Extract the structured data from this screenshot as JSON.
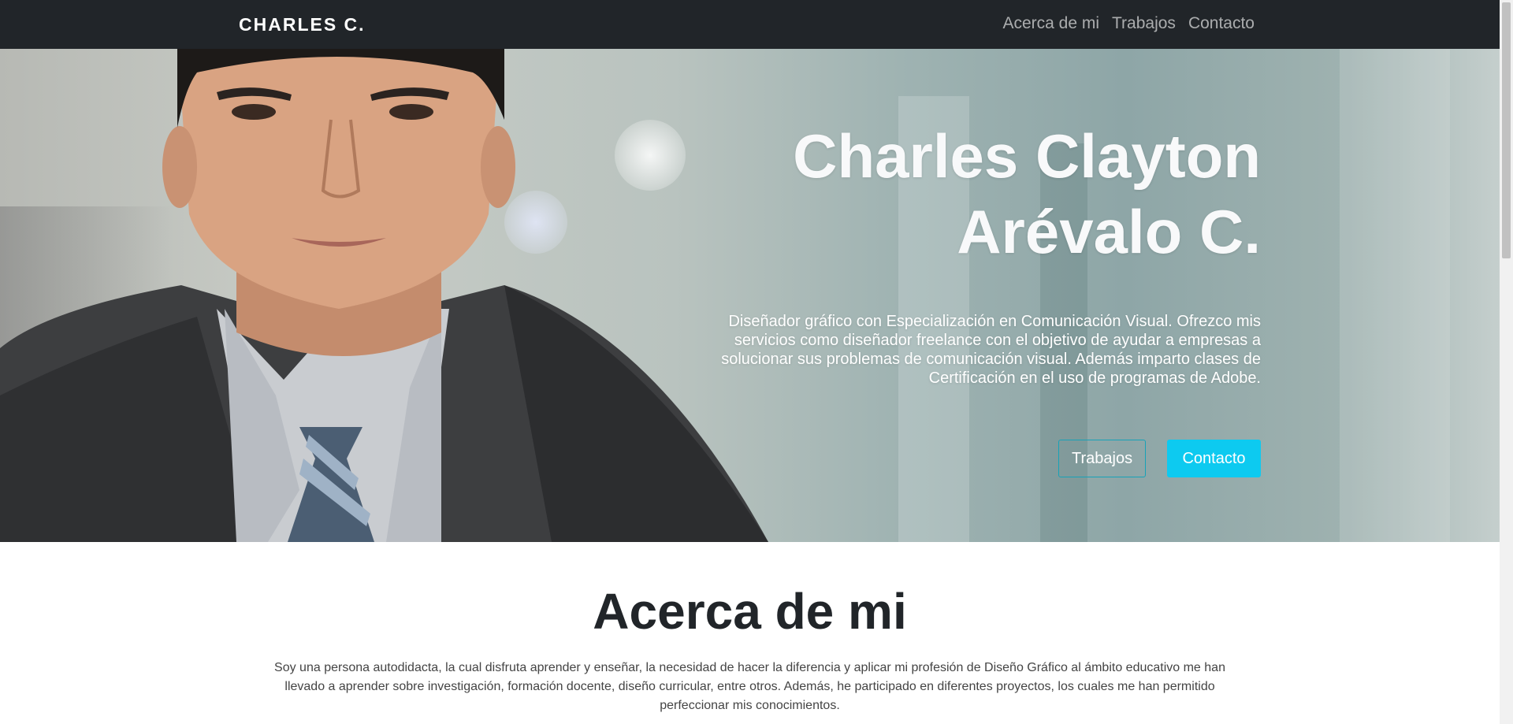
{
  "navbar": {
    "brand": "CHARLES C.",
    "links": [
      "Acerca de mi",
      "Trabajos",
      "Contacto"
    ]
  },
  "hero": {
    "title_line1": "Charles Clayton",
    "title_line2": "Arévalo C.",
    "description_lines": [
      "Diseñador gráfico con Especialización en Comunicación Visual. Ofrezco mis",
      "servicios como diseñador freelance con el objetivo de ayudar a empresas a",
      "solucionar sus problemas de comunicación visual. Además imparto clases de",
      "Certificación en el uso de programas de Adobe."
    ],
    "button_works": "Trabajos",
    "button_contact": "Contacto"
  },
  "about": {
    "title": "Acerca de mi",
    "text_lines": [
      "Soy una persona autodidacta, la cual disfruta aprender y enseñar, la necesidad de hacer la diferencia y aplicar mi profesión de Diseño Gráfico al ámbito educativo me han",
      "llevado a aprender sobre investigación, formación docente, diseño curricular, entre otros. Además, he participado en diferentes proyectos, los cuales me han permitido",
      "perfeccionar mis conocimientos."
    ]
  },
  "colors": {
    "navbar_bg": "#212529",
    "accent": "#0dcaf0",
    "outline_border": "#17a2b8"
  }
}
